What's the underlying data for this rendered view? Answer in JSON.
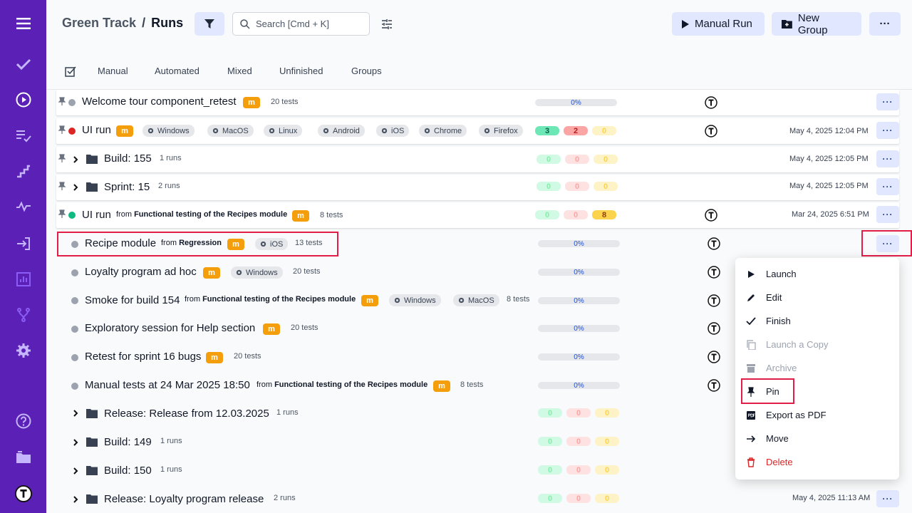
{
  "header": {
    "breadcrumb_project": "Green Track",
    "breadcrumb_sep": "/",
    "breadcrumb_page": "Runs",
    "search_placeholder": "Search [Cmd + K]",
    "manual_run_label": "Manual Run",
    "new_group_label": "New Group",
    "more_label": "···"
  },
  "tabs": [
    "Manual",
    "Automated",
    "Mixed",
    "Unfinished",
    "Groups"
  ],
  "rows": [
    {
      "title": "Welcome tour component_retest",
      "badge": "m",
      "count": "20 tests",
      "progress": "0%"
    },
    {
      "title": "UI run",
      "badge": "m",
      "envs": [
        "Windows",
        "MacOS",
        "Linux",
        "Android",
        "iOS",
        "Chrome",
        "Firefox"
      ],
      "stats": [
        "3",
        "2",
        "0"
      ],
      "date": "May 4, 2025 12:04 PM"
    },
    {
      "title": "Build: 155",
      "count": "1 runs",
      "stats": [
        "0",
        "0",
        "0"
      ],
      "date": "May 4, 2025 12:05 PM"
    },
    {
      "title": "Sprint: 15",
      "count": "2 runs",
      "stats": [
        "0",
        "0",
        "0"
      ],
      "date": "May 4, 2025 12:05 PM"
    },
    {
      "title": "UI run",
      "from": "from",
      "source": "Functional testing of the Recipes module",
      "badge": "m",
      "count": "8 tests",
      "stats": [
        "0",
        "0",
        "8"
      ],
      "date": "Mar 24, 2025 6:51 PM"
    },
    {
      "title": "Recipe module",
      "from": "from",
      "source": "Regression",
      "badge": "m",
      "envs": [
        "iOS"
      ],
      "count": "13 tests",
      "progress": "0%"
    },
    {
      "title": "Loyalty program ad hoc",
      "badge": "m",
      "envs": [
        "Windows"
      ],
      "count": "20 tests",
      "progress": "0%"
    },
    {
      "title": "Smoke for build 154",
      "from": "from",
      "source": "Functional testing of the Recipes module",
      "badge": "m",
      "envs": [
        "Windows",
        "MacOS"
      ],
      "count": "8 tests",
      "progress": "0%"
    },
    {
      "title": "Exploratory session for Help section",
      "badge": "m",
      "count": "20 tests",
      "progress": "0%"
    },
    {
      "title": "Retest for sprint 16 bugs",
      "badge": "m",
      "count": "20 tests",
      "progress": "0%"
    },
    {
      "title": "Manual tests at 24 Mar 2025 18:50",
      "from": "from",
      "source": "Functional testing of the Recipes module",
      "badge": "m",
      "count": "8 tests",
      "progress": "0%"
    },
    {
      "title": "Release: Release from 12.03.2025",
      "count": "1 runs",
      "stats": [
        "0",
        "0",
        "0"
      ]
    },
    {
      "title": "Build: 149",
      "count": "1 runs",
      "stats": [
        "0",
        "0",
        "0"
      ]
    },
    {
      "title": "Build: 150",
      "count": "1 runs",
      "stats": [
        "0",
        "0",
        "0"
      ]
    },
    {
      "title": "Release: Loyalty program release",
      "count": "2 runs",
      "stats": [
        "0",
        "0",
        "0"
      ],
      "date": "May 4, 2025 11:13 AM"
    }
  ],
  "menu": [
    "Launch",
    "Edit",
    "Finish",
    "Launch a Copy",
    "Archive",
    "Pin",
    "Export as PDF",
    "Move",
    "Delete"
  ],
  "colors": {
    "sidebar": "#5b21b6",
    "accent_light": "#e0e7ff",
    "badge": "#f59e0b",
    "highlight": "#e11d48",
    "danger": "#dc2626"
  }
}
